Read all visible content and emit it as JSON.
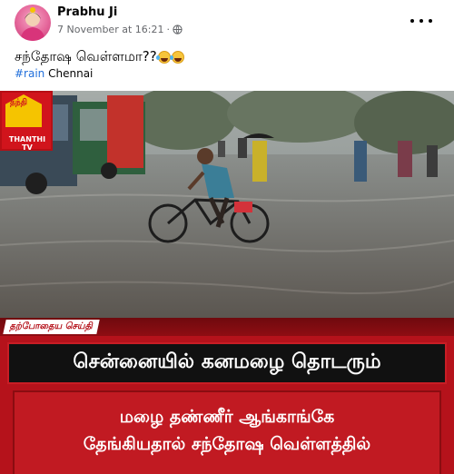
{
  "post": {
    "author": "Prabhu Ji",
    "timestamp": "7 November at 16:21",
    "separator": "·",
    "privacy_icon": "globe-icon",
    "more_icon": "more-options-icon",
    "caption": "சந்தோஷ வெள்ளமா??",
    "caption_emojis": [
      "tears-of-joy-emoji",
      "tears-of-joy-emoji"
    ],
    "hashtag": "#rain",
    "location_text": "Chennai"
  },
  "image": {
    "logo_top_text": "தந்தி",
    "logo_text": "THANTHI TV",
    "brand_strip": "தற்போதைய செய்தி",
    "headline": "சென்னையில் கனமழை தொடரும்",
    "sub_lines": [
      "மழை தண்ணீர் ஆங்காங்கே",
      "தேங்கியதால் சந்தோஷ வெள்ளத்தில்"
    ]
  },
  "colors": {
    "link": "#216fdb",
    "banner_red": "#b5121b",
    "headline_bg": "#111111",
    "logo_yellow": "#f5c400"
  }
}
